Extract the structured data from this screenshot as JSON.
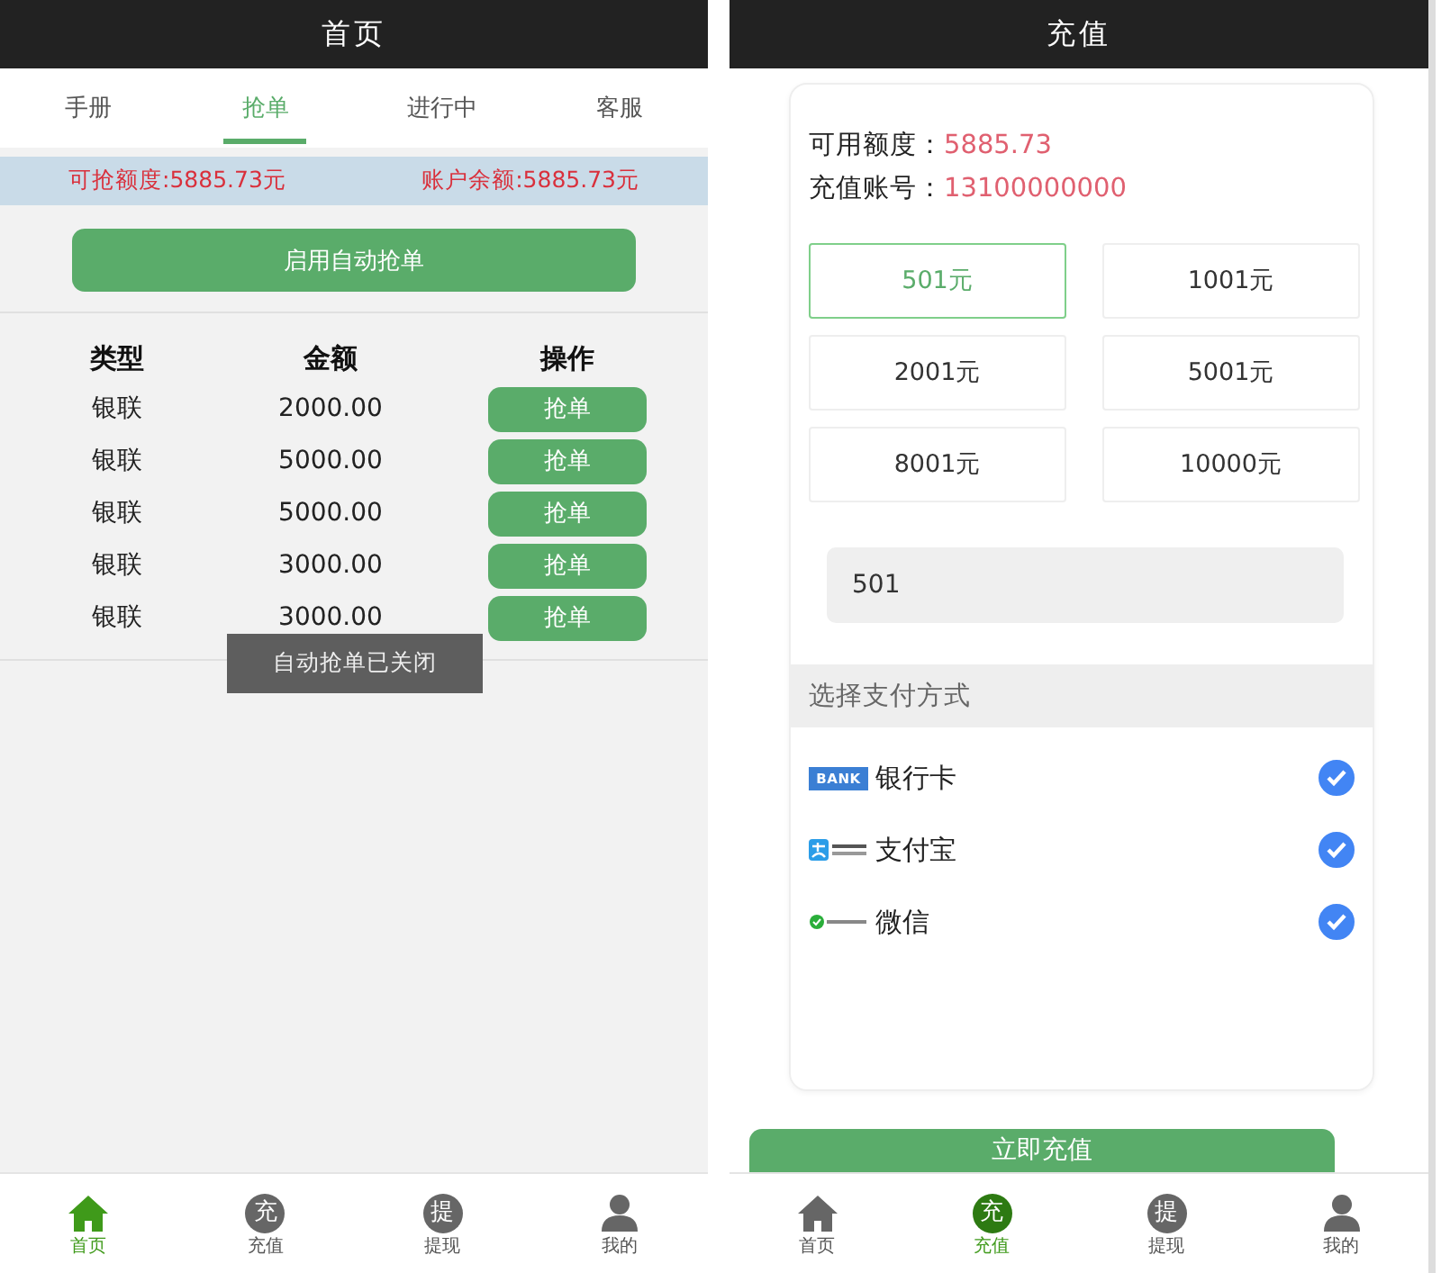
{
  "home": {
    "title": "首页",
    "tabs": [
      {
        "label": "手册",
        "selected": false
      },
      {
        "label": "抢单",
        "selected": true
      },
      {
        "label": "进行中",
        "selected": false
      },
      {
        "label": "客服",
        "selected": false
      }
    ],
    "info_bar": {
      "grab_limit": "可抢额度:5885.73元",
      "balance": "账户余额:5885.73元"
    },
    "auto_button": "启用自动抢单",
    "table": {
      "columns": [
        "类型",
        "金额",
        "操作"
      ],
      "rows": [
        {
          "type": "银联",
          "amount": "2000.00",
          "action": "抢单"
        },
        {
          "type": "银联",
          "amount": "5000.00",
          "action": "抢单"
        },
        {
          "type": "银联",
          "amount": "5000.00",
          "action": "抢单"
        },
        {
          "type": "银联",
          "amount": "3000.00",
          "action": "抢单"
        },
        {
          "type": "银联",
          "amount": "3000.00",
          "action": "抢单"
        }
      ]
    },
    "toast": "自动抢单已关闭",
    "nav": [
      {
        "kind": "house",
        "label": "首页",
        "selected": true
      },
      {
        "kind": "glyph",
        "glyph": "充",
        "label": "充值",
        "selected": false
      },
      {
        "kind": "glyph",
        "glyph": "提",
        "label": "提现",
        "selected": false
      },
      {
        "kind": "person",
        "label": "我的",
        "selected": false
      }
    ]
  },
  "recharge": {
    "title": "充值",
    "available_label": "可用额度：",
    "available_value": "5885.73",
    "account_label": "充值账号：",
    "account_value": "13100000000",
    "amounts": [
      {
        "label": "501元",
        "selected": true
      },
      {
        "label": "1001元",
        "selected": false
      },
      {
        "label": "2001元",
        "selected": false
      },
      {
        "label": "5001元",
        "selected": false
      },
      {
        "label": "8001元",
        "selected": false
      },
      {
        "label": "10000元",
        "selected": false
      }
    ],
    "amount_field": {
      "value": "501"
    },
    "payment_heading": "选择支付方式",
    "payments": [
      {
        "kind": "bank",
        "logo_text": "BANK",
        "label": "银行卡",
        "checked": true
      },
      {
        "kind": "alipay",
        "label": "支付宝",
        "checked": true
      },
      {
        "kind": "wechat",
        "label": "微信",
        "checked": true
      }
    ],
    "submit_button": "立即充值",
    "nav": [
      {
        "kind": "house",
        "label": "首页",
        "selected": false
      },
      {
        "kind": "glyph",
        "glyph": "充",
        "label": "充值",
        "selected": true
      },
      {
        "kind": "glyph",
        "glyph": "提",
        "label": "提现",
        "selected": false
      },
      {
        "kind": "person",
        "label": "我的",
        "selected": false
      }
    ]
  }
}
